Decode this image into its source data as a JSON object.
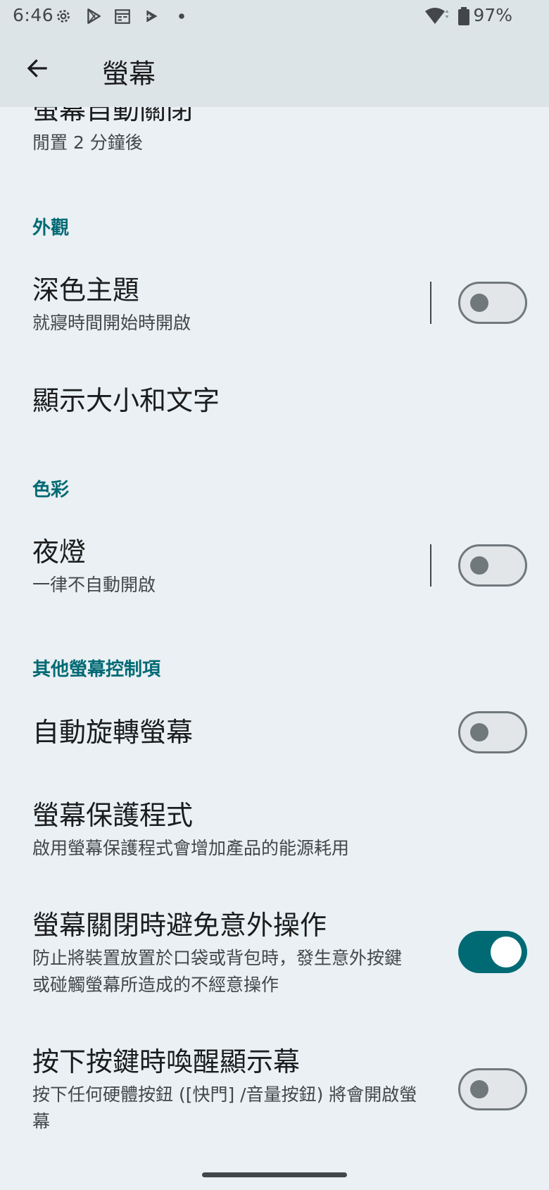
{
  "status_bar": {
    "time": "6:46",
    "battery": "97%",
    "icons": [
      "settings-icon",
      "play-store-icon",
      "calendar-icon",
      "play-games-icon",
      "dot-icon",
      "wifi-icon",
      "battery-icon"
    ]
  },
  "app_bar": {
    "title": "螢幕",
    "back_icon": "arrow-back-icon"
  },
  "items": {
    "screen_timeout": {
      "title": "螢幕自動關閉",
      "summary": "閒置 2 分鐘後"
    },
    "appearance_header": "外觀",
    "dark_theme": {
      "title": "深色主題",
      "summary": "就寢時間開始時開啟",
      "enabled": false
    },
    "display_size": {
      "title": "顯示大小和文字"
    },
    "color_header": "色彩",
    "night_light": {
      "title": "夜燈",
      "summary": "一律不自動開啟",
      "enabled": false
    },
    "other_header": "其他螢幕控制項",
    "auto_rotate": {
      "title": "自動旋轉螢幕",
      "enabled": false
    },
    "screensaver": {
      "title": "螢幕保護程式",
      "summary": "啟用螢幕保護程式會增加產品的能源耗用"
    },
    "pocket_mode": {
      "title": "螢幕關閉時避免意外操作",
      "summary_line1": "防止將裝置放置於口袋或背包時，發生意外按鍵",
      "summary_line2": "或碰觸螢幕所造成的不經意操作",
      "enabled": true
    },
    "wake_on_key": {
      "title": "按下按鍵時喚醒顯示幕",
      "summary_line1": "按下任何硬體按鈕 ([快門] /音量按鈕) 將會開啟螢",
      "summary_line2": "幕",
      "enabled": false
    }
  },
  "colors": {
    "accent": "#006a74",
    "background": "#eaf0f3",
    "app_bar": "#dde4e8"
  }
}
